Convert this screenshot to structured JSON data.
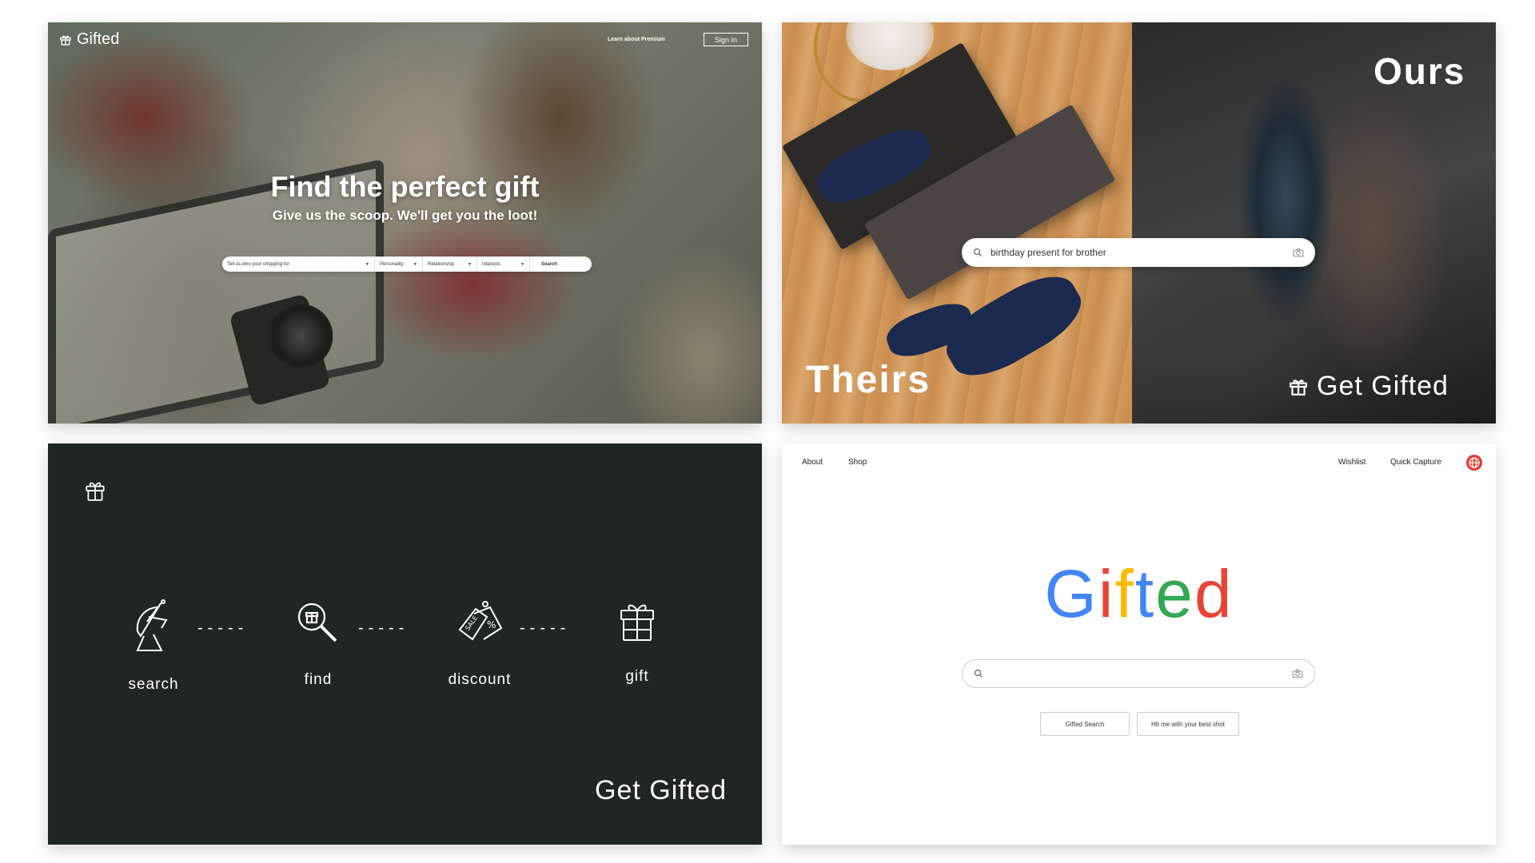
{
  "panel1": {
    "logo": "Gifted",
    "nav_premium": "Learn about Premium",
    "signin": "Sign In",
    "title": "Find the perfect gift",
    "subtitle": "Give us the scoop. We'll get you the loot!",
    "search": {
      "who": "Tell us who your shopping for",
      "personality": "Personality",
      "relationship": "Relationship",
      "interests": "Interests",
      "button": "Search"
    }
  },
  "panel2": {
    "theirs": "Theirs",
    "ours": "Ours",
    "get_gifted": "Get Gifted",
    "search_value": "birthday present for brother"
  },
  "panel3": {
    "steps": [
      "search",
      "find",
      "discount",
      "gift"
    ],
    "tagline": "Get Gifted"
  },
  "panel4": {
    "nav": {
      "about": "About",
      "shop": "Shop",
      "wishlist": "Wishlist",
      "quick_capture": "Quick Capture"
    },
    "brand_letters": [
      {
        "ch": "G",
        "color": "#4285F4"
      },
      {
        "ch": "i",
        "color": "#EA4335"
      },
      {
        "ch": "f",
        "color": "#FBBC05"
      },
      {
        "ch": "t",
        "color": "#4285F4"
      },
      {
        "ch": "e",
        "color": "#34A853"
      },
      {
        "ch": "d",
        "color": "#EA4335"
      }
    ],
    "button_search": "Gifted Search",
    "button_lucky": "Hit me with your best shot"
  }
}
